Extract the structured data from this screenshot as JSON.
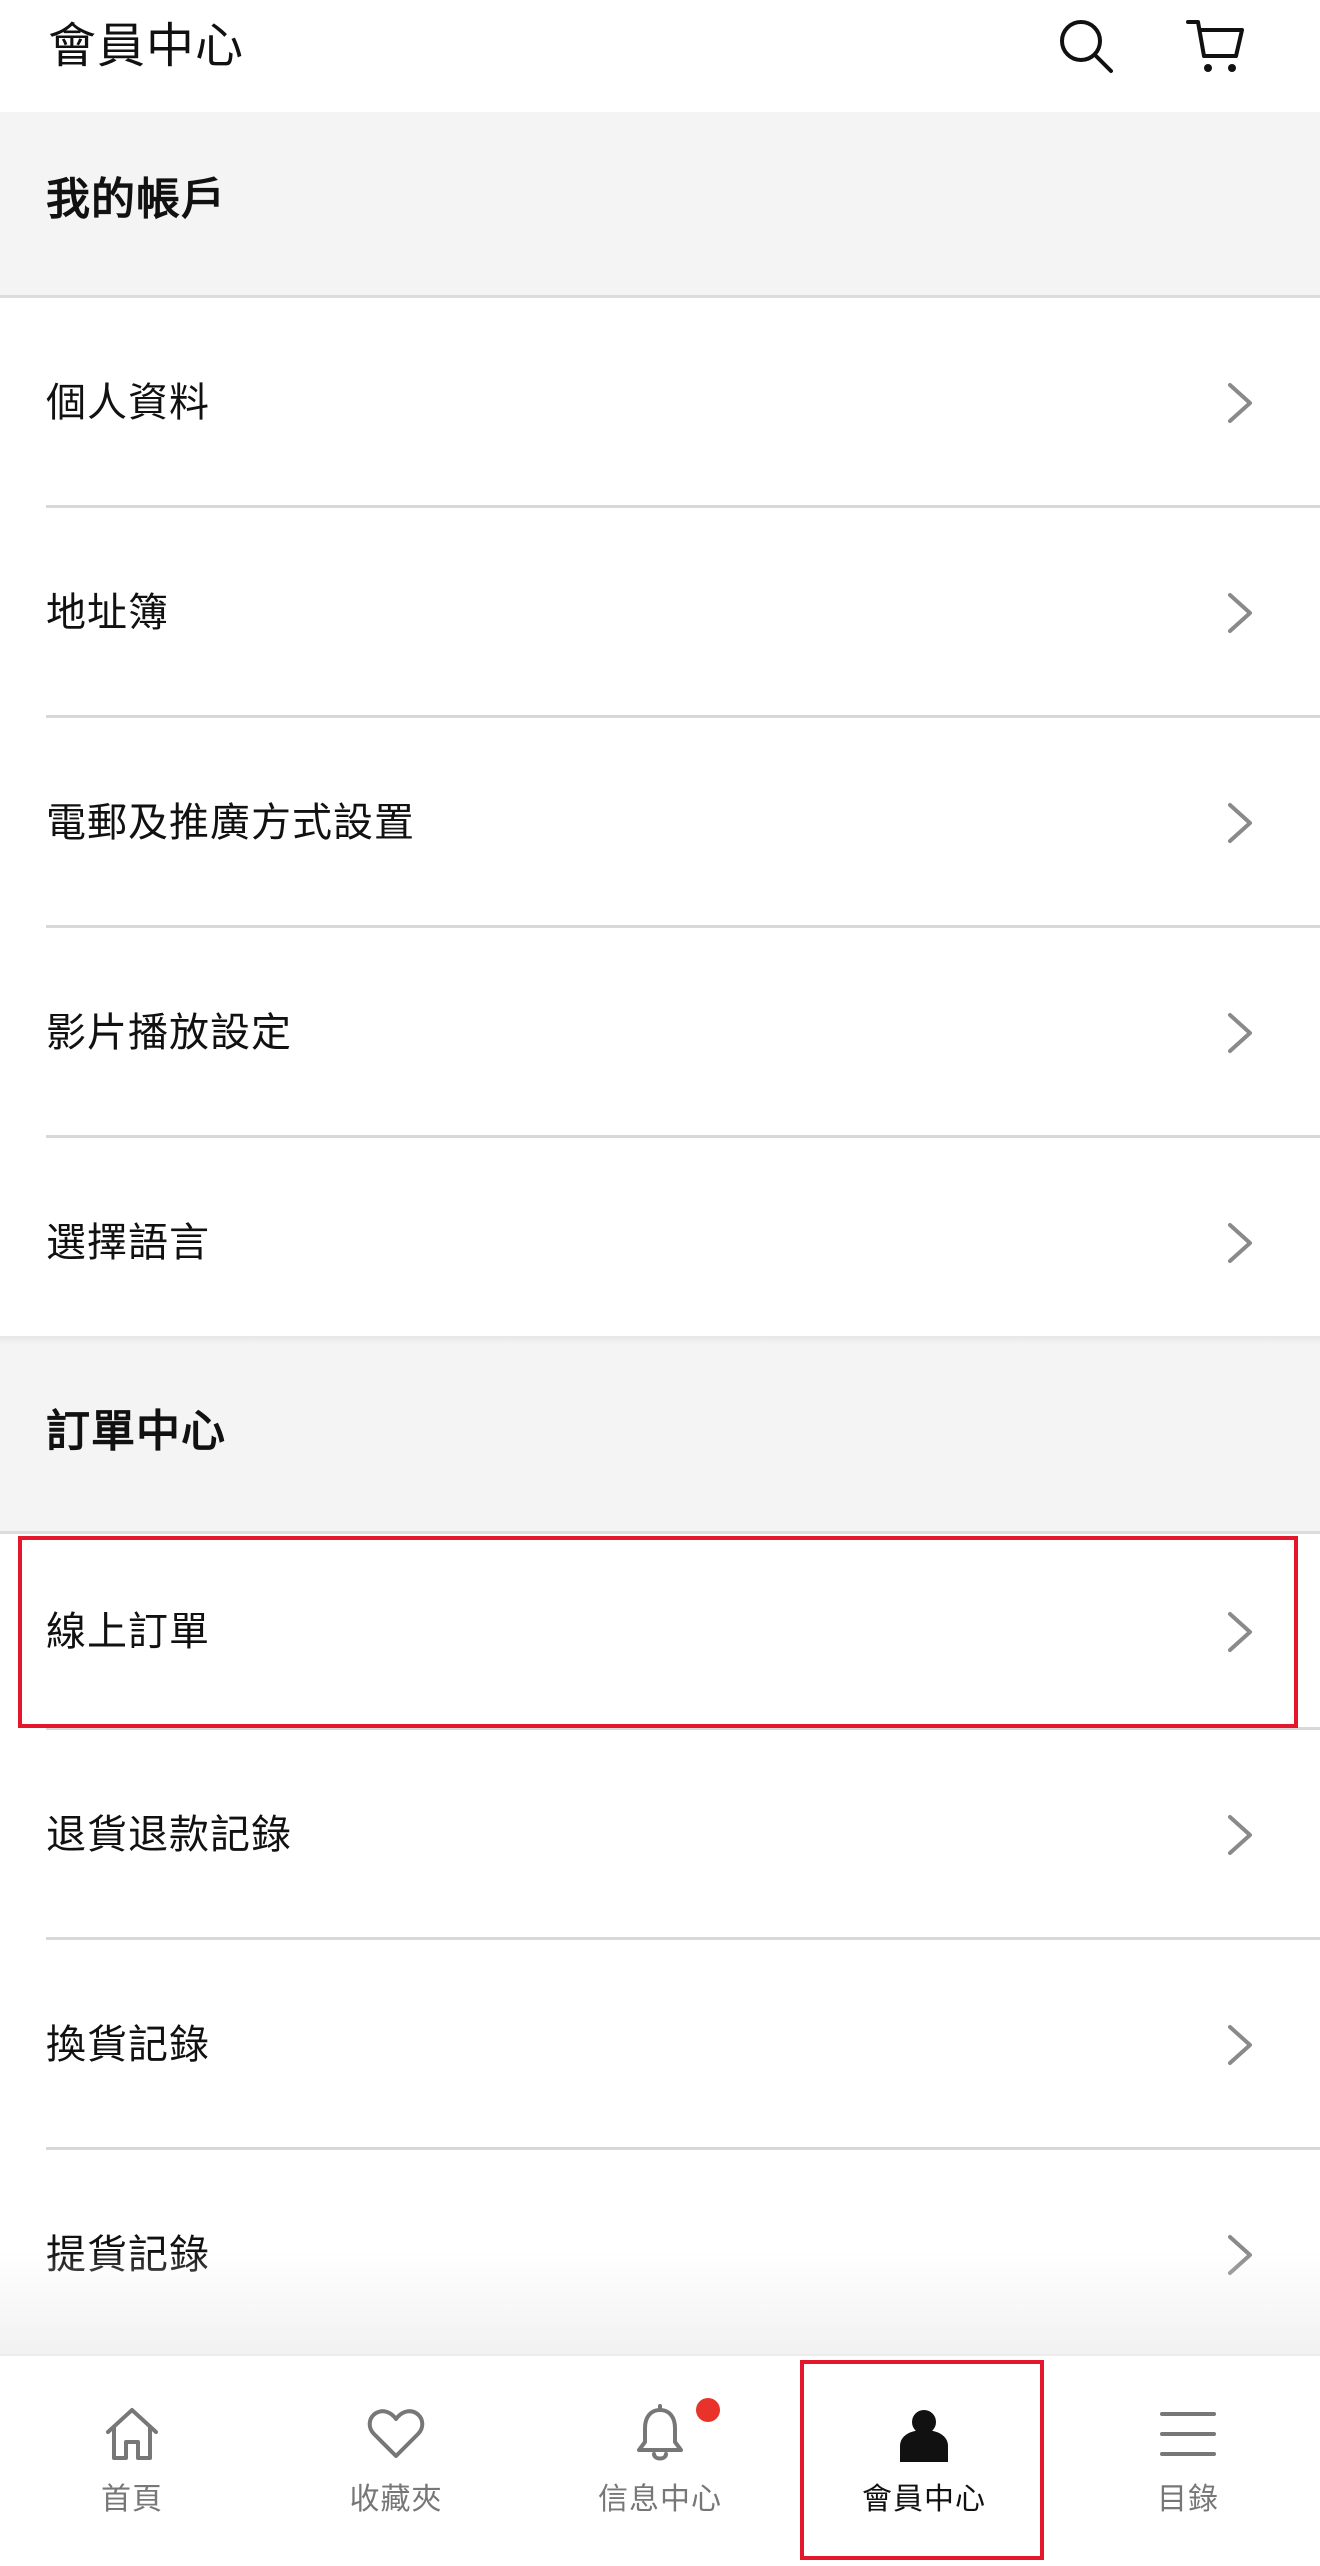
{
  "header": {
    "title": "會員中心",
    "search_icon": "search-icon",
    "cart_icon": "cart-icon"
  },
  "sections": [
    {
      "title": "我的帳戶",
      "items": [
        {
          "label": "個人資料"
        },
        {
          "label": "地址簿"
        },
        {
          "label": "電郵及推廣方式設置"
        },
        {
          "label": "影片播放設定"
        },
        {
          "label": "選擇語言"
        }
      ]
    },
    {
      "title": "訂單中心",
      "items": [
        {
          "label": "線上訂單"
        },
        {
          "label": "退貨退款記錄"
        },
        {
          "label": "換貨記錄"
        },
        {
          "label": "提貨記錄"
        }
      ]
    }
  ],
  "bottom_nav": {
    "items": [
      {
        "label": "首頁",
        "icon": "home-icon",
        "active": false
      },
      {
        "label": "收藏夾",
        "icon": "heart-icon",
        "active": false
      },
      {
        "label": "信息中心",
        "icon": "bell-icon",
        "active": false,
        "badge": true
      },
      {
        "label": "會員中心",
        "icon": "user-icon",
        "active": true
      },
      {
        "label": "目錄",
        "icon": "menu-icon",
        "active": false
      }
    ]
  },
  "colors": {
    "highlight": "#e3182d",
    "badge": "#e8322a",
    "section_bg": "#f4f4f4",
    "text": "#111111",
    "muted": "#777777"
  }
}
